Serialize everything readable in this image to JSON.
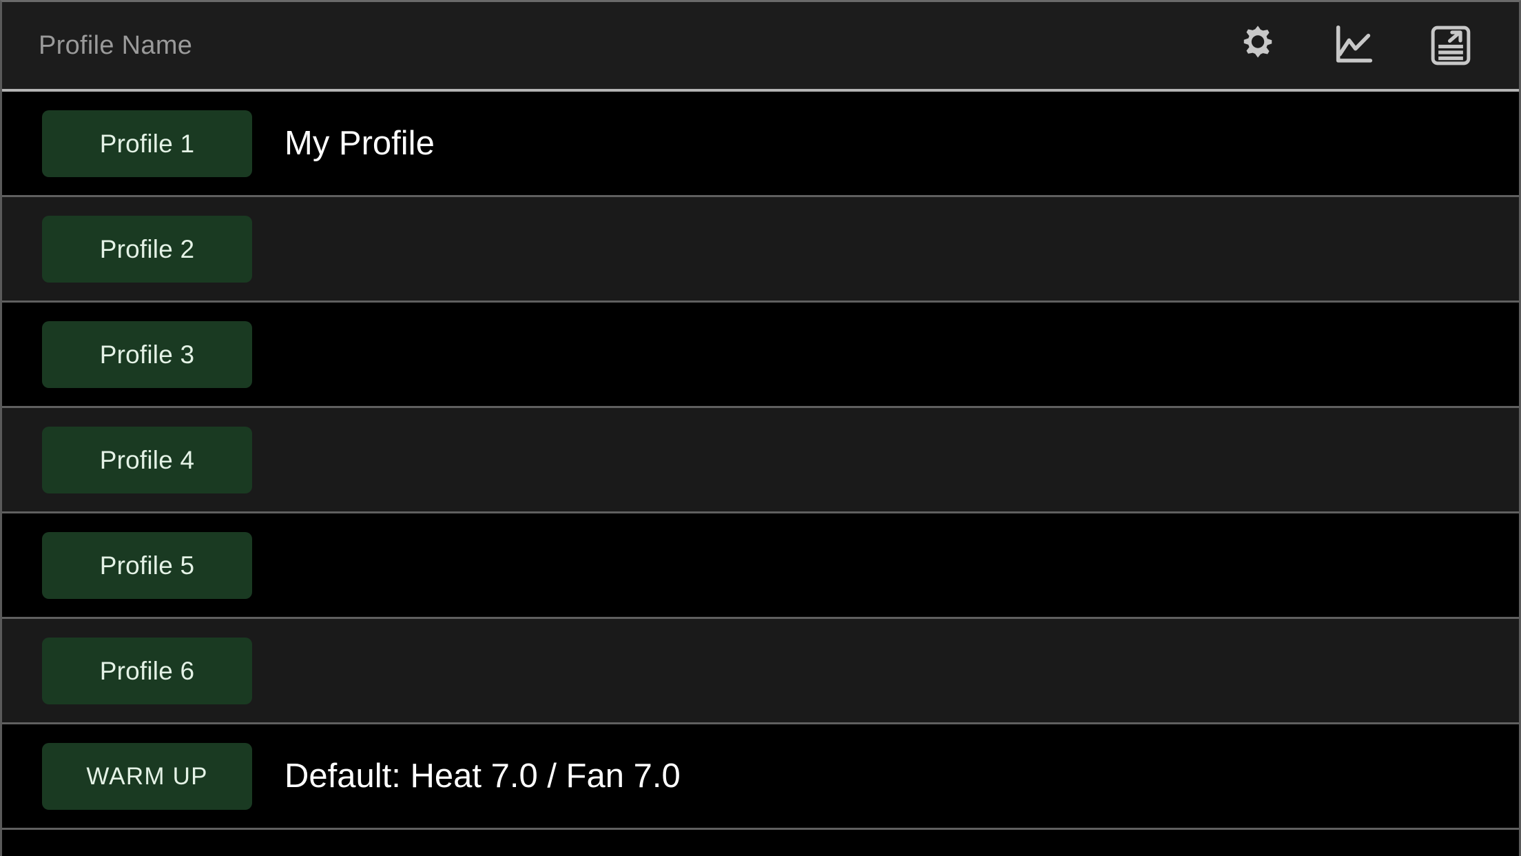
{
  "header": {
    "title": "Profile Name",
    "actions": [
      {
        "name": "settings-button",
        "icon": "gear-icon"
      },
      {
        "name": "graph-button",
        "icon": "line-chart-icon"
      },
      {
        "name": "export-log-button",
        "icon": "export-document-icon"
      }
    ]
  },
  "colors": {
    "accent_button": "#1a3a22",
    "button_text": "#e4f2e6",
    "row_black": "#000000",
    "row_gray": "#1a1a1a",
    "separator": "#606060",
    "header_bg": "#1c1c1c",
    "header_title": "#9a9a9a",
    "value_text": "#ffffff"
  },
  "rows": [
    {
      "button_label": "Profile 1",
      "value": "My Profile",
      "background": "black"
    },
    {
      "button_label": "Profile 2",
      "value": "",
      "background": "gray"
    },
    {
      "button_label": "Profile 3",
      "value": "",
      "background": "black"
    },
    {
      "button_label": "Profile 4",
      "value": "",
      "background": "gray"
    },
    {
      "button_label": "Profile 5",
      "value": "",
      "background": "black"
    },
    {
      "button_label": "Profile 6",
      "value": "",
      "background": "gray"
    },
    {
      "button_label": "WARM UP",
      "value": "Default: Heat 7.0 / Fan 7.0",
      "background": "black"
    }
  ]
}
